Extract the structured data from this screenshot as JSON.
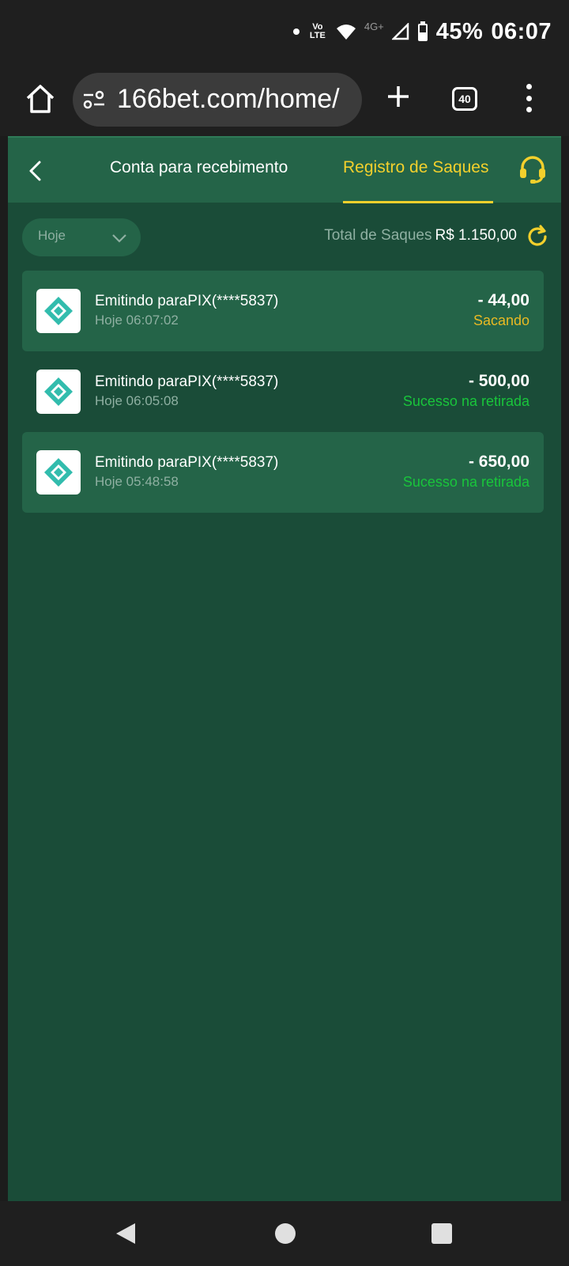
{
  "status_bar": {
    "volte": "Vo LTE",
    "network": "4G+",
    "battery": "45%",
    "time": "06:07"
  },
  "browser": {
    "url": "166bet.com/home/",
    "tab_count": "40"
  },
  "header": {
    "tab_account": "Conta para recebimento",
    "tab_records": "Registro de Saques"
  },
  "filter": {
    "selected": "Hoje"
  },
  "summary": {
    "total_label": "Total de Saques",
    "total_value": "R$ 1.150,00"
  },
  "records": [
    {
      "title": "Emitindo paraPIX(****5837)",
      "time": "Hoje 06:07:02",
      "amount": "- 44,00",
      "status": "Sacando",
      "status_color": "#e9b923"
    },
    {
      "title": "Emitindo paraPIX(****5837)",
      "time": "Hoje 06:05:08",
      "amount": "- 500,00",
      "status": "Sucesso na retirada",
      "status_color": "#19c53b"
    },
    {
      "title": "Emitindo paraPIX(****5837)",
      "time": "Hoje 05:48:58",
      "amount": "- 650,00",
      "status": "Sucesso na retirada",
      "status_color": "#19c53b"
    }
  ],
  "colors": {
    "accent": "#f3d02c",
    "background": "#1a4c38",
    "surface": "#246448",
    "pix": "#32bcad"
  }
}
